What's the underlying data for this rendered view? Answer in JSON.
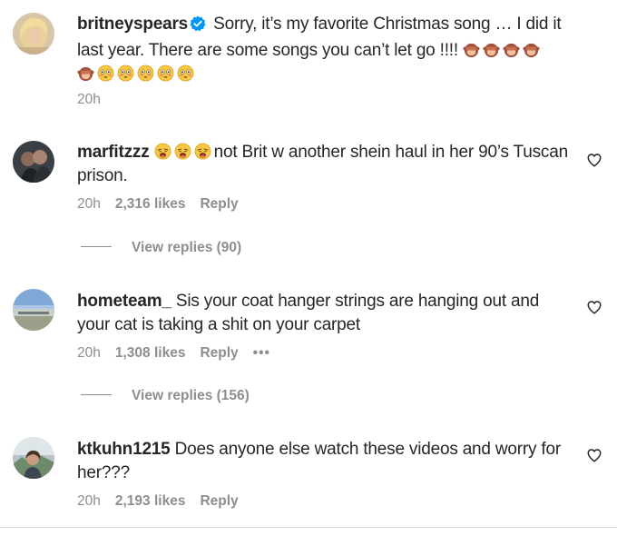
{
  "comments": [
    {
      "username": "britneyspears",
      "verified": true,
      "text": "Sorry, it’s my favorite Christmas song … I did it last year. There are some songs you can’t let go !!!!",
      "time": "20h",
      "likes": "",
      "reply_label": ""
    },
    {
      "username": "marfitzzz",
      "text_after_emoji": "not Brit w another shein haul in her 90’s Tuscan prison.",
      "time": "20h",
      "likes": "2,316 likes",
      "reply_label": "Reply",
      "view_replies": "View replies (90)"
    },
    {
      "username": "hometeam_",
      "text": "Sis your coat hanger strings are hanging out and your cat is taking a shit on your carpet",
      "time": "20h",
      "likes": "1,308 likes",
      "reply_label": "Reply",
      "more": "•••",
      "view_replies": "View replies (156)"
    },
    {
      "username": "ktkuhn1215",
      "text": "Does anyone else watch these videos and worry for her???",
      "time": "20h",
      "likes": "2,193 likes",
      "reply_label": "Reply"
    }
  ],
  "icons": {
    "verified": "verified-badge-icon",
    "like": "heart-icon",
    "emoji_monkey": "see-no-evil-monkey-emoji",
    "emoji_flushed": "flushed-face-emoji",
    "emoji_weary": "weary-face-emoji"
  },
  "colors": {
    "text": "#262626",
    "secondary": "#8e8e8e",
    "verified": "#0095f6",
    "divider": "#dbdbdb"
  }
}
